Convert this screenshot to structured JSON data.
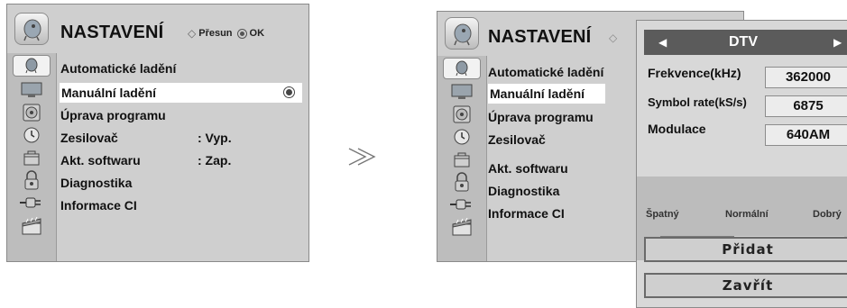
{
  "left_menu": {
    "title": "NASTAVENÍ",
    "hint_move": "Přesun",
    "hint_ok": "OK",
    "items": [
      {
        "label": "Automatické ladění",
        "value": ""
      },
      {
        "label": "Manuální ladění",
        "value": ""
      },
      {
        "label": "Úprava programu",
        "value": ""
      },
      {
        "label": "Zesilovač",
        "value": ": Vyp."
      },
      {
        "label": "Akt. softwaru",
        "value": ": Zap."
      },
      {
        "label": "Diagnostika",
        "value": ""
      },
      {
        "label": "Informace CI",
        "value": ""
      }
    ],
    "selected_index": 1
  },
  "right_menu": {
    "title": "NASTAVENÍ",
    "items": [
      {
        "label": "Automatické ladění"
      },
      {
        "label": "Manuální ladění"
      },
      {
        "label": "Úprava programu"
      },
      {
        "label": "Zesilovač"
      },
      {
        "label": "Akt. softwaru"
      },
      {
        "label": "Diagnostika"
      },
      {
        "label": "Informace CI"
      }
    ]
  },
  "tab_icons": [
    "satellite-dish-icon",
    "tv-screen-icon",
    "speaker-icon",
    "clock-icon",
    "lock-icon",
    "lock-padlock-icon",
    "plug-icon",
    "clapperboard-icon"
  ],
  "arrow_glyph": "≫",
  "dialog": {
    "mode": "DTV",
    "frequency_label": "Frekvence(kHz)",
    "frequency_value": "362000",
    "symbol_rate_label": "Symbol rate(kS/s)",
    "symbol_rate_value": "6875",
    "modulation_label": "Modulace",
    "modulation_value": "640AM",
    "signal_bad": "Špatný",
    "signal_normal": "Normální",
    "signal_good": "Dobrý",
    "signal_level": 0.4,
    "add_button": "Přidat",
    "close_button": "Zavřít"
  },
  "colors": {
    "menu_bg": "#cfcfcf",
    "icon_column_bg": "#bdbdbd",
    "dialog_header_bg": "#5b5b5b",
    "selection_bg": "#ffffff",
    "signal_fill": "#7a7a7a"
  }
}
